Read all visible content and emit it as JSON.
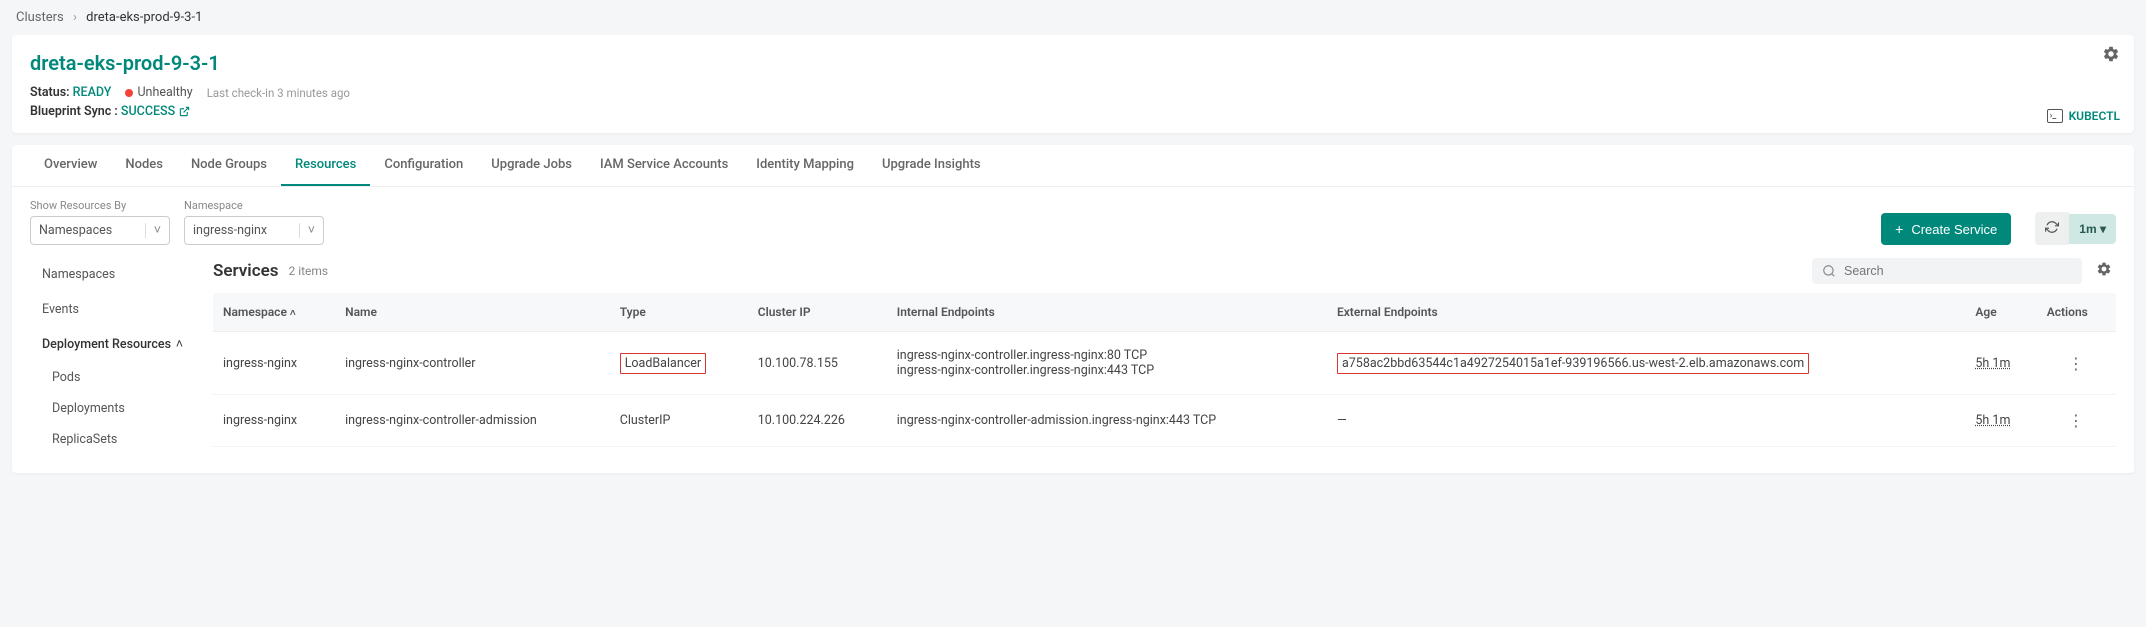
{
  "breadcrumb": {
    "root": "Clusters",
    "current": "dreta-eks-prod-9-3-1"
  },
  "header": {
    "title": "dreta-eks-prod-9-3-1",
    "status_label": "Status:",
    "status_value": "READY",
    "health": "Unhealthy",
    "checkin": "Last check-in 3 minutes ago",
    "blueprint_label": "Blueprint Sync :",
    "blueprint_value": "SUCCESS",
    "kubectl": "KUBECTL"
  },
  "tabs": [
    "Overview",
    "Nodes",
    "Node Groups",
    "Resources",
    "Configuration",
    "Upgrade Jobs",
    "IAM Service Accounts",
    "Identity Mapping",
    "Upgrade Insights"
  ],
  "active_tab_index": 3,
  "filters": {
    "show_by_label": "Show Resources By",
    "show_by_value": "Namespaces",
    "namespace_label": "Namespace",
    "namespace_value": "ingress-nginx"
  },
  "create_button": "Create Service",
  "refresh_interval": "1m",
  "sidebar": {
    "items": [
      "Namespaces",
      "Events"
    ],
    "group_label": "Deployment Resources",
    "sub_items": [
      "Pods",
      "Deployments",
      "ReplicaSets"
    ]
  },
  "main": {
    "title": "Services",
    "count": "2 items",
    "search_placeholder": "Search"
  },
  "table": {
    "columns": [
      "Namespace",
      "Name",
      "Type",
      "Cluster IP",
      "Internal Endpoints",
      "External Endpoints",
      "Age",
      "Actions"
    ],
    "rows": [
      {
        "namespace": "ingress-nginx",
        "name": "ingress-nginx-controller",
        "type": "LoadBalancer",
        "type_highlight": true,
        "cluster_ip": "10.100.78.155",
        "internal1": "ingress-nginx-controller.ingress-nginx:80 TCP",
        "internal2": "ingress-nginx-controller.ingress-nginx:443 TCP",
        "external": "a758ac2bbd63544c1a4927254015a1ef-939196566.us-west-2.elb.amazonaws.com",
        "external_highlight": true,
        "age": "5h 1m"
      },
      {
        "namespace": "ingress-nginx",
        "name": "ingress-nginx-controller-admission",
        "type": "ClusterIP",
        "type_highlight": false,
        "cluster_ip": "10.100.224.226",
        "internal1": "ingress-nginx-controller-admission.ingress-nginx:443 TCP",
        "internal2": "",
        "external": "—",
        "external_highlight": false,
        "age": "5h 1m"
      }
    ]
  }
}
